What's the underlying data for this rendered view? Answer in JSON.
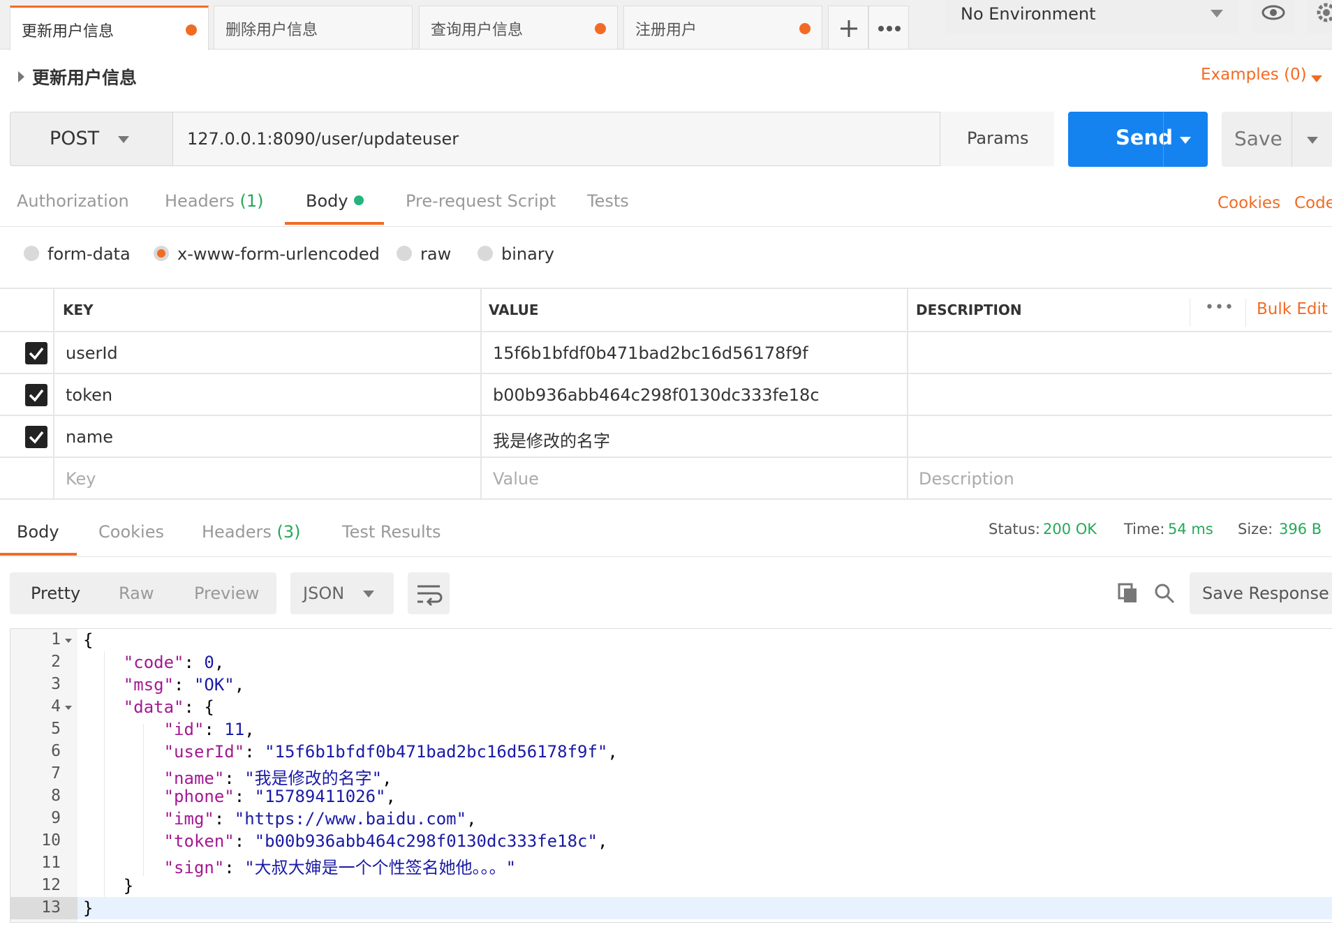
{
  "tabs": [
    {
      "label": "更新用户信息",
      "modified": true,
      "active": true
    },
    {
      "label": "删除用户信息",
      "modified": false,
      "active": false
    },
    {
      "label": "查询用户信息",
      "modified": true,
      "active": false
    },
    {
      "label": "注册用户",
      "modified": true,
      "active": false
    }
  ],
  "environment": {
    "selected": "No Environment"
  },
  "request": {
    "title": "更新用户信息",
    "examples_label": "Examples (0)",
    "method": "POST",
    "url": "127.0.0.1:8090/user/updateuser",
    "params_label": "Params",
    "send_label": "Send",
    "save_label": "Save"
  },
  "request_tabs": {
    "authorization": "Authorization",
    "headers": "Headers",
    "headers_count": "(1)",
    "body": "Body",
    "prerequest": "Pre-request Script",
    "tests": "Tests",
    "cookies": "Cookies",
    "code": "Code"
  },
  "body_modes": {
    "form_data": "form-data",
    "urlencoded": "x-www-form-urlencoded",
    "raw": "raw",
    "binary": "binary",
    "selected": "x-www-form-urlencoded"
  },
  "params_table": {
    "headers": {
      "key": "KEY",
      "value": "VALUE",
      "description": "DESCRIPTION"
    },
    "more": "•••",
    "bulk_edit": "Bulk Edit",
    "rows": [
      {
        "checked": true,
        "key": "userId",
        "value": "15f6b1bfdf0b471bad2bc16d56178f9f",
        "description": ""
      },
      {
        "checked": true,
        "key": "token",
        "value": "b00b936abb464c298f0130dc333fe18c",
        "description": ""
      },
      {
        "checked": true,
        "key": "name",
        "value": "我是修改的名字",
        "description": ""
      }
    ],
    "placeholders": {
      "key": "Key",
      "value": "Value",
      "description": "Description"
    }
  },
  "response": {
    "tabs": {
      "body": "Body",
      "cookies": "Cookies",
      "headers": "Headers",
      "headers_count": "(3)",
      "test_results": "Test Results"
    },
    "status_label": "Status:",
    "status": "200 OK",
    "time_label": "Time:",
    "time": "54 ms",
    "size_label": "Size:",
    "size": "396 B",
    "view_modes": {
      "pretty": "Pretty",
      "raw": "Raw",
      "preview": "Preview",
      "selected": "Pretty"
    },
    "format": "JSON",
    "save_response": "Save Response",
    "line_numbers": [
      "1",
      "2",
      "3",
      "4",
      "5",
      "6",
      "7",
      "8",
      "9",
      "10",
      "11",
      "12",
      "13"
    ],
    "json": {
      "code_key": "\"code\"",
      "code_val": "0",
      "msg_key": "\"msg\"",
      "msg_val": "\"OK\"",
      "data_key": "\"data\"",
      "id_key": "\"id\"",
      "id_val": "11",
      "userId_key": "\"userId\"",
      "userId_val": "\"15f6b1bfdf0b471bad2bc16d56178f9f\"",
      "name_key": "\"name\"",
      "name_val": "\"我是修改的名字\"",
      "phone_key": "\"phone\"",
      "phone_val": "\"15789411026\"",
      "img_key": "\"img\"",
      "img_val": "\"https://www.baidu.com\"",
      "token_key": "\"token\"",
      "token_val": "\"b00b936abb464c298f0130dc333fe18c\"",
      "sign_key": "\"sign\"",
      "sign_val": "\"大叔大婶是一个个性签名她他。。。\""
    }
  },
  "colors": {
    "accent": "#f26b24",
    "send": "#1483f0",
    "success": "#24a957"
  }
}
